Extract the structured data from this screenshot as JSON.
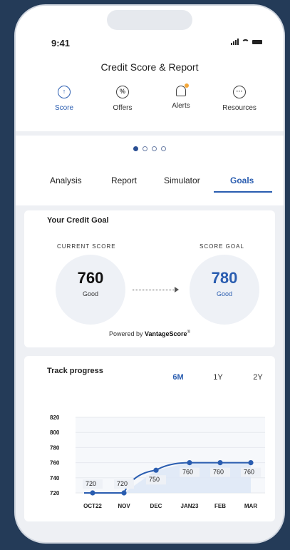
{
  "status": {
    "time": "9:41"
  },
  "header": {
    "title": "Credit Score & Report"
  },
  "nav": [
    {
      "label": "Score",
      "icon": "gauge-icon",
      "active": true
    },
    {
      "label": "Offers",
      "icon": "percent-icon",
      "active": false
    },
    {
      "label": "Alerts",
      "icon": "bell-icon",
      "active": false
    },
    {
      "label": "Resources",
      "icon": "ellipsis-icon",
      "active": false
    }
  ],
  "tabs": [
    {
      "label": "Analysis",
      "active": false
    },
    {
      "label": "Report",
      "active": false
    },
    {
      "label": "Simulator",
      "active": false
    },
    {
      "label": "Goals",
      "active": true
    }
  ],
  "goal": {
    "title": "Your Credit Goal",
    "current_label": "CURRENT SCORE",
    "current_score": "760",
    "current_grade": "Good",
    "goal_label": "SCORE GOAL",
    "goal_score": "780",
    "goal_grade": "Good",
    "powered_prefix": "Powered by ",
    "powered_brand": "VantageScore",
    "powered_mark": "®"
  },
  "track": {
    "title": "Track progress",
    "ranges": [
      {
        "label": "6M",
        "active": true
      },
      {
        "label": "1Y",
        "active": false
      },
      {
        "label": "2Y",
        "active": false
      }
    ]
  },
  "colors": {
    "accent": "#2a5db0",
    "line": "#2a5db0",
    "fill": "#dfe8f6",
    "background": "#243b58"
  },
  "chart_data": {
    "type": "line",
    "categories": [
      "OCT22",
      "NOV",
      "DEC",
      "JAN23",
      "FEB",
      "MAR"
    ],
    "values": [
      720,
      720,
      750,
      760,
      760,
      760
    ],
    "data_labels": [
      "720",
      "720",
      "750",
      "760",
      "760",
      "760"
    ],
    "yticks": [
      "720",
      "740",
      "760",
      "780",
      "800",
      "820"
    ],
    "ylim": [
      720,
      820
    ]
  }
}
